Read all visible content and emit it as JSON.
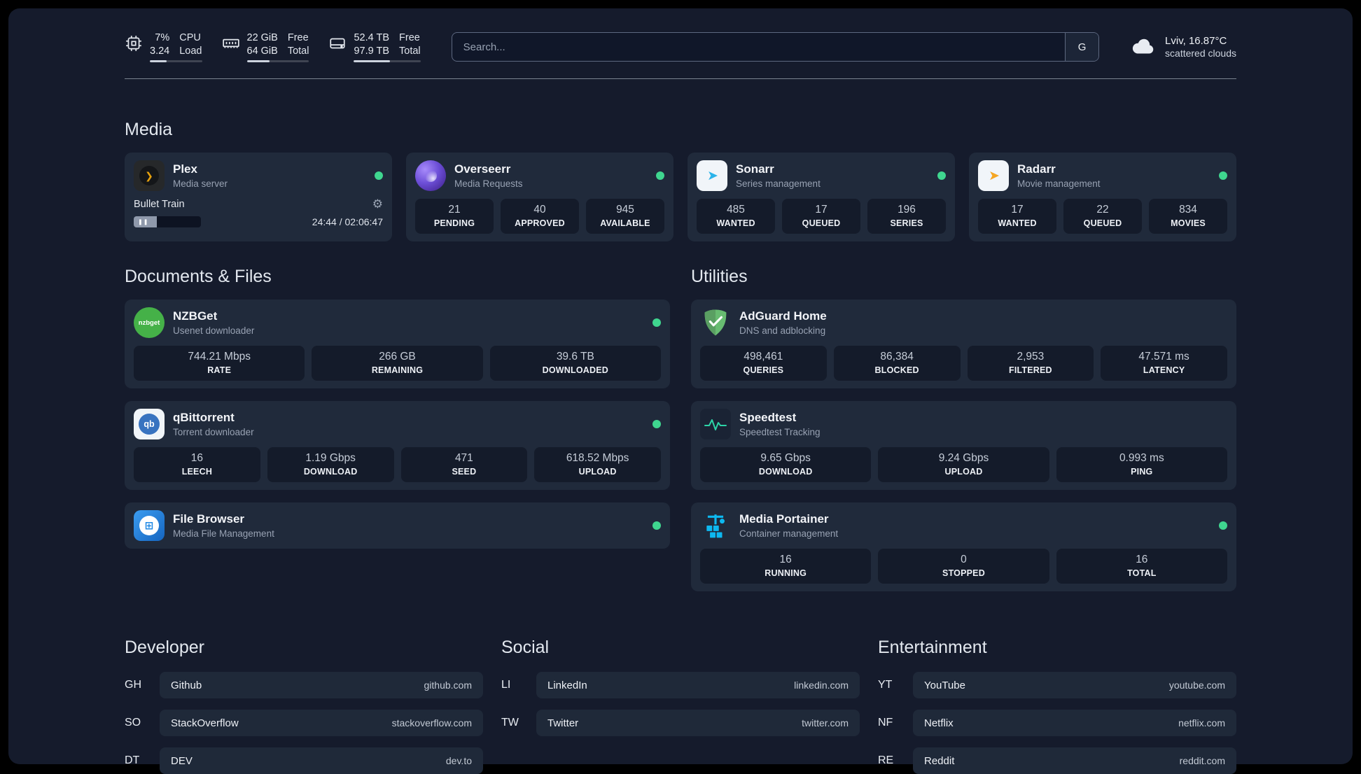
{
  "colors": {
    "page_bg": "#151b2c",
    "card_bg": "#202a3b",
    "stat_bg": "#141b2a",
    "status_green": "#3fd68f",
    "plex_amber": "#e5a00d",
    "overseerr_purple": "#6d4fd8",
    "sonarr_blue": "#2bb3ea",
    "radarr_amber": "#f5a623",
    "nzbget_green": "#45b148",
    "qbittorrent_blue": "#3873c0",
    "filebrowser_blue": "#1e88e5",
    "adguard_green": "#68bc71",
    "portainer_blue": "#0db8f0"
  },
  "topbar": {
    "widgets": [
      {
        "icon": "cpu-icon",
        "values": [
          "7%",
          "3.24"
        ],
        "labels": [
          "CPU",
          "Load"
        ],
        "bar_pct": 32
      },
      {
        "icon": "memory-icon",
        "values": [
          "22 GiB",
          "64 GiB"
        ],
        "labels": [
          "Free",
          "Total"
        ],
        "bar_pct": 36
      },
      {
        "icon": "disk-icon",
        "values": [
          "52.4 TB",
          "97.9 TB"
        ],
        "labels": [
          "Free",
          "Total"
        ],
        "bar_pct": 54
      }
    ],
    "search": {
      "placeholder": "Search...",
      "provider_label": "G"
    },
    "weather": {
      "icon": "cloud-icon",
      "location": "Lviv, 16.87°C",
      "condition": "scattered clouds"
    }
  },
  "sections": {
    "media": {
      "title": "Media",
      "plex": {
        "name": "Plex",
        "subtitle": "Media server",
        "now_playing": "Bullet Train",
        "time": "24:44 / 02:06:47",
        "progress_pct": 34,
        "pause_glyph": "❚❚",
        "gear_glyph": "⚙"
      },
      "services": [
        {
          "name": "Overseerr",
          "subtitle": "Media Requests",
          "icon": "overseerr-icon",
          "stats": [
            {
              "value": "21",
              "label": "PENDING"
            },
            {
              "value": "40",
              "label": "APPROVED"
            },
            {
              "value": "945",
              "label": "AVAILABLE"
            }
          ]
        },
        {
          "name": "Sonarr",
          "subtitle": "Series management",
          "icon": "sonarr-icon",
          "stats": [
            {
              "value": "485",
              "label": "WANTED"
            },
            {
              "value": "17",
              "label": "QUEUED"
            },
            {
              "value": "196",
              "label": "SERIES"
            }
          ]
        },
        {
          "name": "Radarr",
          "subtitle": "Movie management",
          "icon": "radarr-icon",
          "stats": [
            {
              "value": "17",
              "label": "WANTED"
            },
            {
              "value": "22",
              "label": "QUEUED"
            },
            {
              "value": "834",
              "label": "MOVIES"
            }
          ]
        }
      ]
    },
    "documents": {
      "title": "Documents & Files",
      "services": [
        {
          "name": "NZBGet",
          "subtitle": "Usenet downloader",
          "icon": "nzbget-icon",
          "icon_text": "nzbget",
          "stats": [
            {
              "value": "744.21 Mbps",
              "label": "RATE"
            },
            {
              "value": "266 GB",
              "label": "REMAINING"
            },
            {
              "value": "39.6 TB",
              "label": "DOWNLOADED"
            }
          ]
        },
        {
          "name": "qBittorrent",
          "subtitle": "Torrent downloader",
          "icon": "qbittorrent-icon",
          "icon_text": "qb",
          "stats": [
            {
              "value": "16",
              "label": "LEECH"
            },
            {
              "value": "1.19 Gbps",
              "label": "DOWNLOAD"
            },
            {
              "value": "471",
              "label": "SEED"
            },
            {
              "value": "618.52 Mbps",
              "label": "UPLOAD"
            }
          ]
        },
        {
          "name": "File Browser",
          "subtitle": "Media File Management",
          "icon": "filebrowser-icon"
        }
      ]
    },
    "utilities": {
      "title": "Utilities",
      "services": [
        {
          "name": "AdGuard Home",
          "subtitle": "DNS and adblocking",
          "icon": "adguard-icon",
          "stats": [
            {
              "value": "498,461",
              "label": "QUERIES"
            },
            {
              "value": "86,384",
              "label": "BLOCKED"
            },
            {
              "value": "2,953",
              "label": "FILTERED"
            },
            {
              "value": "47.571 ms",
              "label": "LATENCY"
            }
          ]
        },
        {
          "name": "Speedtest",
          "subtitle": "Speedtest Tracking",
          "icon": "speedtest-icon",
          "stats": [
            {
              "value": "9.65 Gbps",
              "label": "DOWNLOAD"
            },
            {
              "value": "9.24 Gbps",
              "label": "UPLOAD"
            },
            {
              "value": "0.993 ms",
              "label": "PING"
            }
          ]
        },
        {
          "name": "Media Portainer",
          "subtitle": "Container management",
          "icon": "portainer-icon",
          "stats": [
            {
              "value": "16",
              "label": "RUNNING"
            },
            {
              "value": "0",
              "label": "STOPPED"
            },
            {
              "value": "16",
              "label": "TOTAL"
            }
          ]
        }
      ]
    }
  },
  "bookmarks": [
    {
      "title": "Developer",
      "items": [
        {
          "abbr": "GH",
          "name": "Github",
          "url": "github.com"
        },
        {
          "abbr": "SO",
          "name": "StackOverflow",
          "url": "stackoverflow.com"
        },
        {
          "abbr": "DT",
          "name": "DEV",
          "url": "dev.to"
        }
      ]
    },
    {
      "title": "Social",
      "items": [
        {
          "abbr": "LI",
          "name": "LinkedIn",
          "url": "linkedin.com"
        },
        {
          "abbr": "TW",
          "name": "Twitter",
          "url": "twitter.com"
        }
      ]
    },
    {
      "title": "Entertainment",
      "items": [
        {
          "abbr": "YT",
          "name": "YouTube",
          "url": "youtube.com"
        },
        {
          "abbr": "NF",
          "name": "Netflix",
          "url": "netflix.com"
        },
        {
          "abbr": "RE",
          "name": "Reddit",
          "url": "reddit.com"
        }
      ]
    }
  ]
}
